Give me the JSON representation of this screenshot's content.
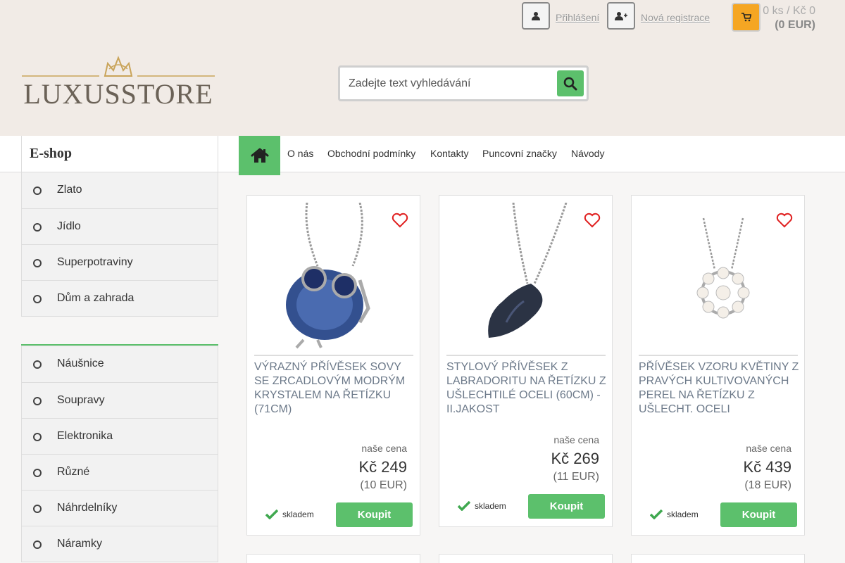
{
  "header": {
    "logo_text": "LUXUSSTORE",
    "search_placeholder": "Zadejte text vyhledávání",
    "login_label": "Přihlášení",
    "register_label": "Nová registrace",
    "cart_summary": "0 ks / Kč 0",
    "cart_eur": "(0 EUR)"
  },
  "nav": {
    "eshop_title": "E-shop",
    "items": [
      "O nás",
      "Obchodní podmínky",
      "Kontakty",
      "Puncovní značky",
      "Návody"
    ]
  },
  "sidebar": {
    "group1": [
      "Zlato",
      "Jídlo",
      "Superpotraviny",
      "Dům a zahrada"
    ],
    "group2": [
      "Náušnice",
      "Soupravy",
      "Elektronika",
      "Různé",
      "Náhrdelníky",
      "Náramky"
    ]
  },
  "products": [
    {
      "title": "VÝRAZNÝ PŘÍVĚSEK SOVY SE ZRCADLOVÝM MODRÝM KRYSTALEM NA ŘETÍZKU (71CM)",
      "price_label": "naše cena",
      "price": "Kč 249",
      "price_eur": "(10 EUR)",
      "stock": "skladem",
      "buy": "Koupit"
    },
    {
      "title": "STYLOVÝ PŘÍVĚSEK Z LABRADORITU NA ŘETÍZKU Z UŠLECHTILÉ OCELI (60CM) - II.JAKOST",
      "price_label": "naše cena",
      "price": "Kč 269",
      "price_eur": "(11 EUR)",
      "stock": "skladem",
      "buy": "Koupit"
    },
    {
      "title": "PŘÍVĚSEK VZORU KVĚTINY Z PRAVÝCH KULTIVOVANÝCH PEREL NA ŘETÍZKU Z UŠLECHT. OCELI",
      "price_label": "naše cena",
      "price": "Kč 439",
      "price_eur": "(18 EUR)",
      "stock": "skladem",
      "buy": "Koupit"
    }
  ],
  "colors": {
    "accent_green": "#5cc06c",
    "cart_orange": "#f5a623",
    "header_bg": "#f1ebe6",
    "heart_red": "#e02020"
  },
  "icons": [
    "user-icon",
    "user-plus-icon",
    "cart-icon",
    "search-icon",
    "home-icon",
    "heart-icon",
    "check-icon",
    "crown-icon"
  ]
}
